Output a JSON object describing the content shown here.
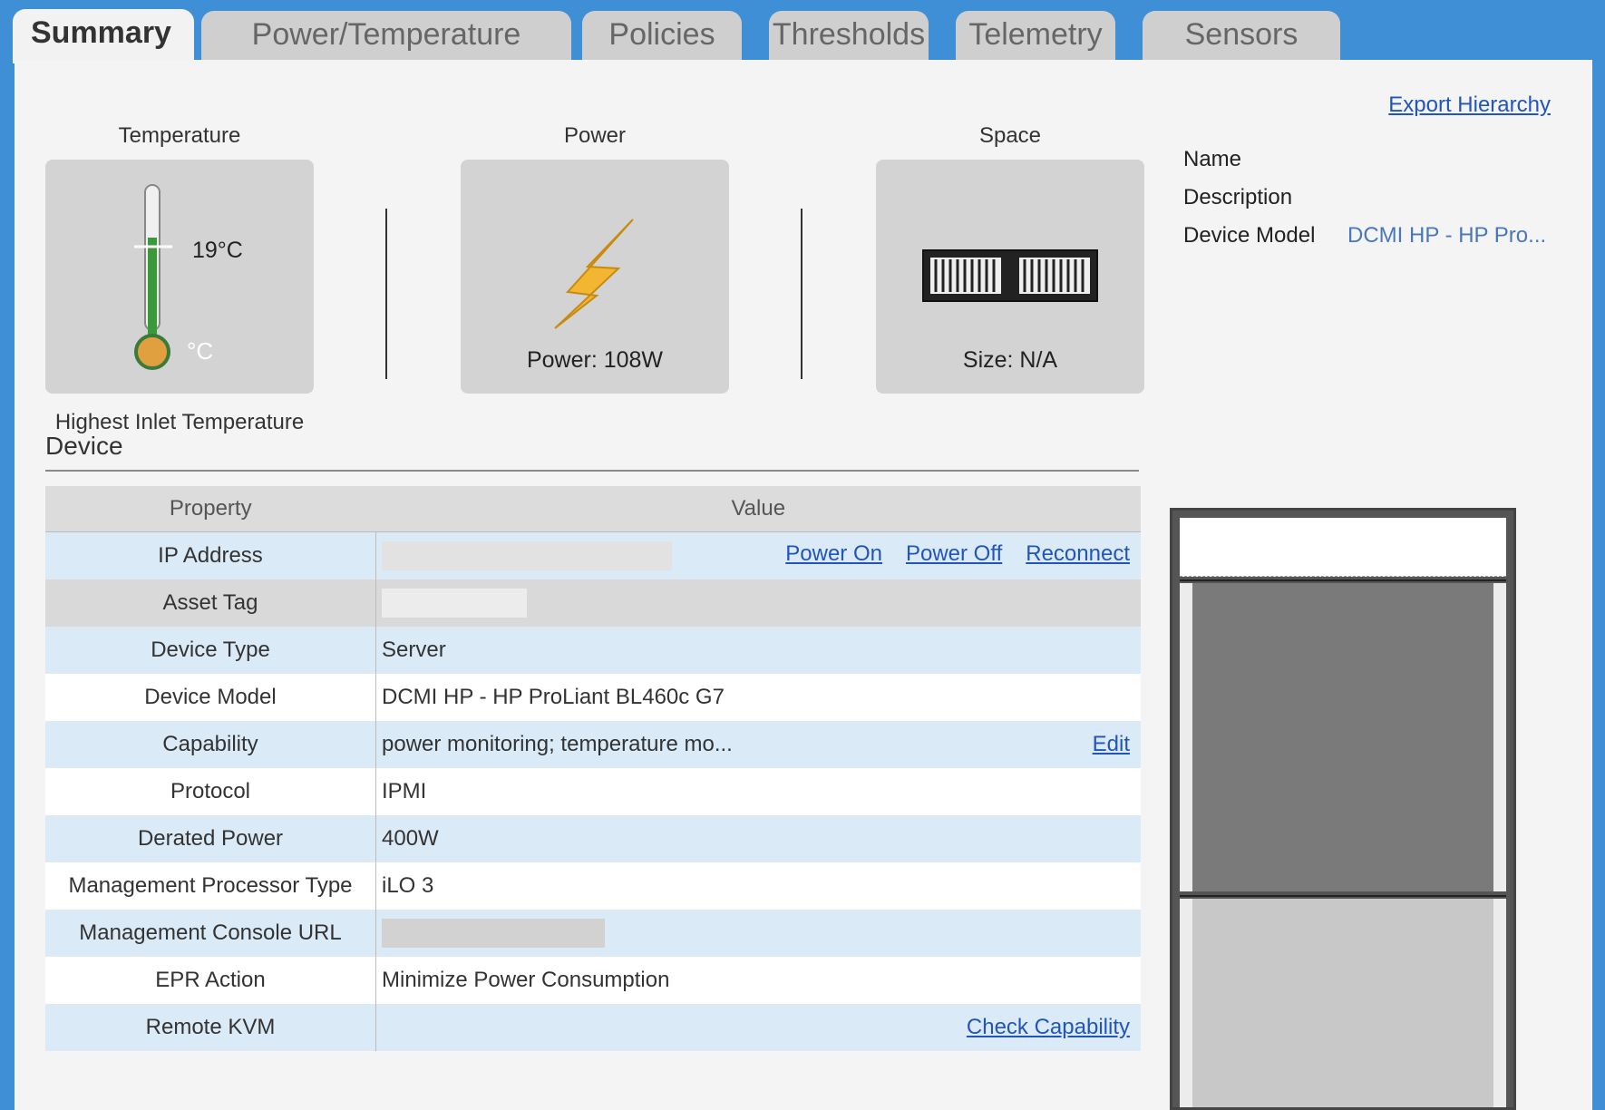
{
  "tabs": [
    {
      "label": "Summary",
      "active": true
    },
    {
      "label": "Power/Temperature",
      "active": false
    },
    {
      "label": "Policies",
      "active": false
    },
    {
      "label": "Thresholds",
      "active": false
    },
    {
      "label": "Telemetry",
      "active": false
    },
    {
      "label": "Sensors",
      "active": false
    }
  ],
  "export_link": "Export Hierarchy",
  "tiles": {
    "temperature": {
      "label": "Temperature",
      "reading": "19°C",
      "unit": "°C",
      "caption": "Highest Inlet Temperature"
    },
    "power": {
      "label": "Power",
      "caption": "Power: 108W"
    },
    "space": {
      "label": "Space",
      "caption": "Size: N/A"
    }
  },
  "info": {
    "name_label": "Name",
    "description_label": "Description",
    "model_label": "Device Model",
    "model_value": "DCMI HP - HP Pro..."
  },
  "device": {
    "title": "Device",
    "headers": {
      "property": "Property",
      "value": "Value"
    },
    "rows": [
      {
        "property": "IP Address",
        "value": ""
      },
      {
        "property": "Asset Tag",
        "value": ""
      },
      {
        "property": "Device Type",
        "value": "Server"
      },
      {
        "property": "Device Model",
        "value": "DCMI HP - HP ProLiant BL460c G7"
      },
      {
        "property": "Capability",
        "value": "power monitoring; temperature mo..."
      },
      {
        "property": "Protocol",
        "value": "IPMI"
      },
      {
        "property": "Derated Power",
        "value": "400W"
      },
      {
        "property": "Management Processor Type",
        "value": "iLO 3"
      },
      {
        "property": "Management Console URL",
        "value": ""
      },
      {
        "property": "EPR Action",
        "value": "Minimize Power Consumption"
      },
      {
        "property": "Remote KVM",
        "value": ""
      }
    ],
    "actions": {
      "power_on": "Power On",
      "power_off": "Power Off",
      "reconnect": "Reconnect",
      "edit": "Edit",
      "check_capability": "Check Capability"
    }
  },
  "colors": {
    "accent_blue": "#3f8fd6",
    "link": "#2255bb",
    "row_blue": "#dbeaf7",
    "thermo_green": "#3a9a3a",
    "bolt": "#f2b632"
  },
  "icons": [
    "thermometer-icon",
    "lightning-bolt-icon",
    "server-chassis-icon"
  ]
}
